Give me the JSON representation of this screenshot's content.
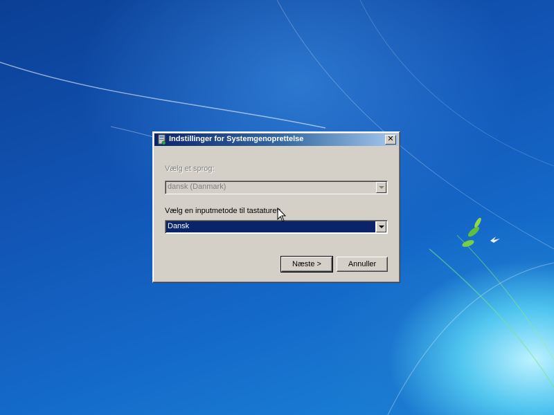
{
  "dialog": {
    "title": "Indstillinger for Systemgenoprettelse",
    "close_label": "✕",
    "language": {
      "label": "Vælg et sprog:",
      "selected": "dansk (Danmark)",
      "enabled": false
    },
    "input_method": {
      "label": "Vælg en inputmetode til tastaturet:",
      "selected": "Dansk",
      "enabled": true
    },
    "buttons": {
      "next": "Næste >",
      "cancel": "Annuller"
    }
  },
  "colors": {
    "titlebar_start": "#0a246a",
    "titlebar_end": "#a6caf0",
    "dialog_face": "#d4d0c8",
    "selection": "#0a246a"
  },
  "icons": {
    "app": "system-recovery-icon",
    "close": "close-icon",
    "dropdown": "chevron-down-icon",
    "cursor": "mouse-cursor-icon"
  }
}
